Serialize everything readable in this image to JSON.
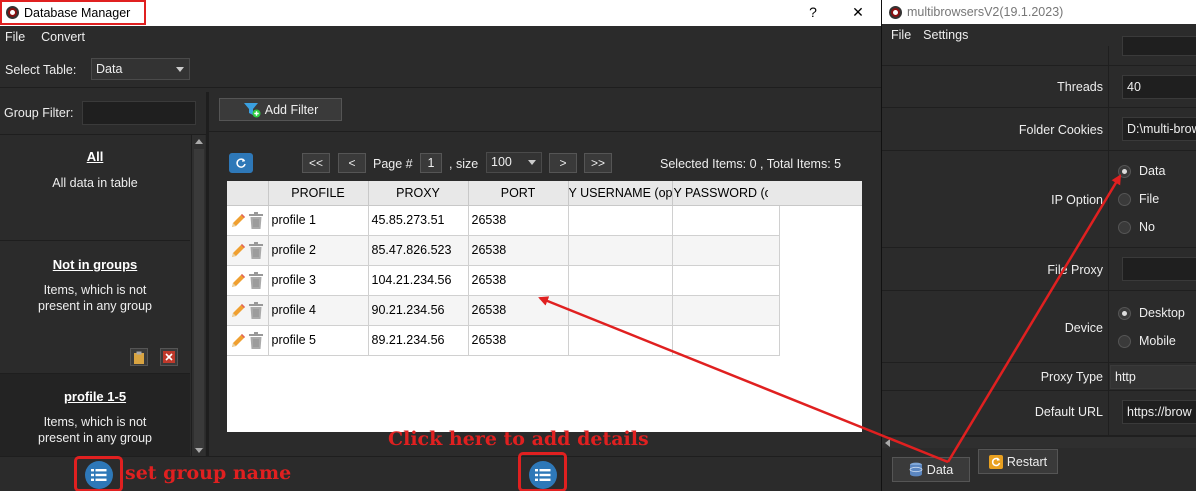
{
  "dbm": {
    "title": "Database Manager",
    "help_label": "?",
    "close_label": "✕",
    "menu": [
      "File",
      "Convert"
    ],
    "select_table_label": "Select Table:",
    "select_table_value": "Data",
    "group_filter_label": "Group Filter:",
    "groups": [
      {
        "name": "All",
        "desc": "All data in table"
      },
      {
        "name": "Not in groups",
        "desc": "Items, which is not present in any group"
      },
      {
        "name": "profile 1-5",
        "desc": "Items, which is not present in any group"
      }
    ],
    "add_filter_label": "Add Filter",
    "pager": {
      "first": "<<",
      "prev": "<",
      "page_label": "Page #",
      "page_value": "1",
      "size_label": ", size",
      "size_value": "100",
      "next": ">",
      "last": ">>",
      "summary": "Selected Items:  0 ,  Total Items:  5"
    },
    "table": {
      "columns": [
        "PROFILE",
        "PROXY",
        "PORT",
        "Y USERNAME (op",
        "Y PASSWORD (op"
      ],
      "rows": [
        [
          "profile 1",
          "45.85.273.51",
          "26538",
          "",
          ""
        ],
        [
          "profile 2",
          "85.47.826.523",
          "26538",
          "",
          ""
        ],
        [
          "profile 3",
          "104.21.234.56",
          "26538",
          "",
          ""
        ],
        [
          "profile 4",
          "90.21.234.56",
          "26538",
          "",
          ""
        ],
        [
          "profile 5",
          "89.21.234.56",
          "26538",
          "",
          ""
        ]
      ]
    },
    "annotations": {
      "add_details": "Click here to add details",
      "group_name": "set group name"
    }
  },
  "mbw": {
    "title": "multibrowsersV2(19.1.2023)",
    "menu": [
      "File",
      "Settings"
    ],
    "threads_label": "Threads",
    "threads_value": "40",
    "folder_cookies_label": "Folder Cookies",
    "folder_cookies_value": "D:\\multi-brow",
    "ip_option_label": "IP Option",
    "ip_options": [
      "Data",
      "File",
      "No"
    ],
    "file_proxy_label": "File Proxy",
    "device_label": "Device",
    "device_options": [
      "Desktop",
      "Mobile"
    ],
    "proxy_type_label": "Proxy Type",
    "proxy_type_value": "http",
    "default_url_label": "Default URL",
    "default_url_value": "https://brow",
    "data_button": "Data",
    "restart_button": "Restart"
  },
  "colors": {
    "annotation_red": "#e02020",
    "panel_dark": "#2b2b2b",
    "accent_blue": "#2e78b8"
  }
}
